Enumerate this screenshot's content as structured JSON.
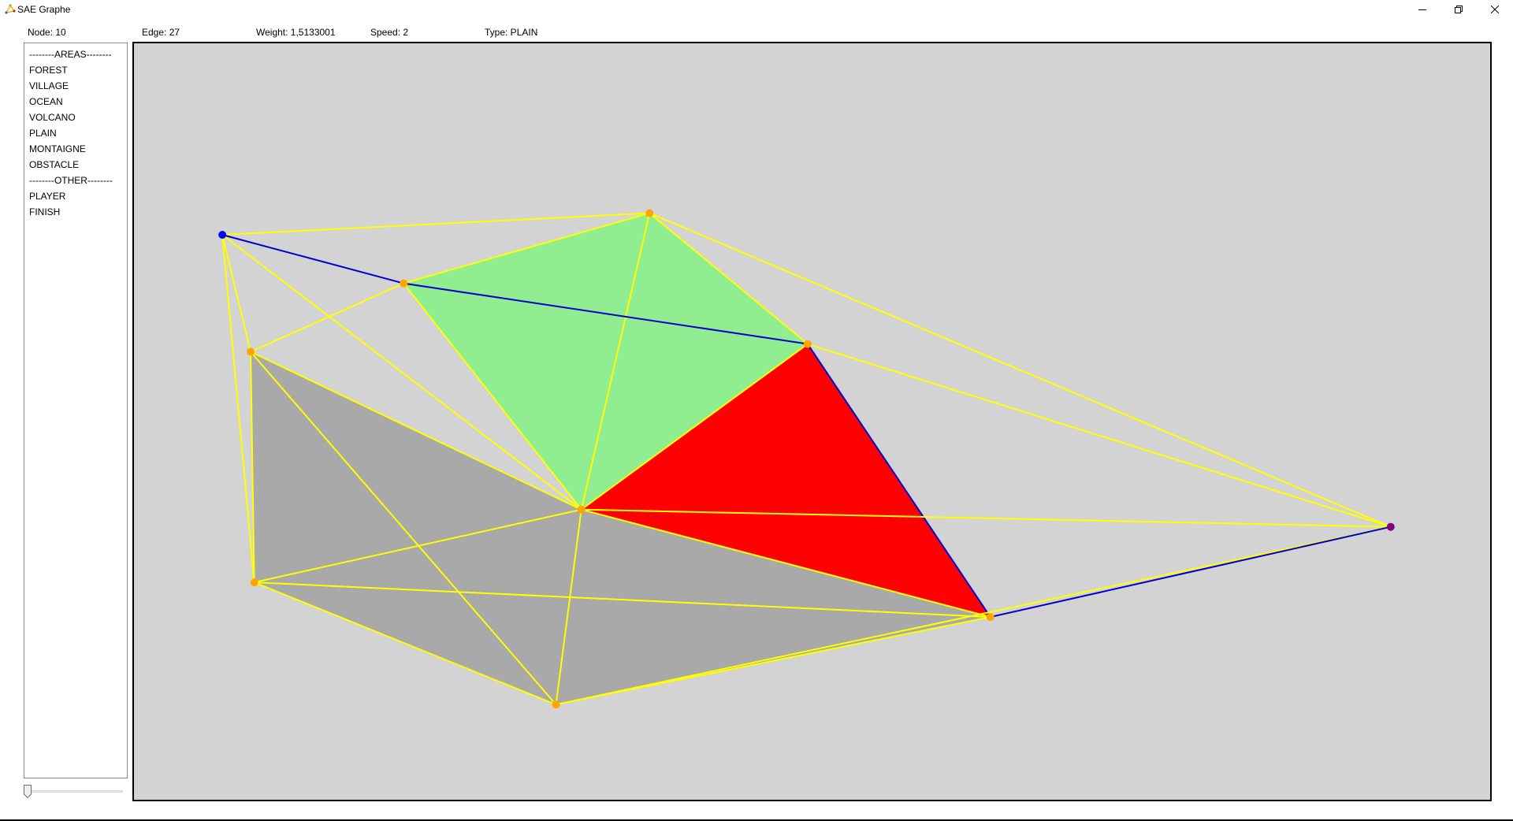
{
  "window": {
    "title": "SAE Graphe"
  },
  "status": {
    "node": "Node: 10",
    "edge": "Edge: 27",
    "weight": "Weight: 1,5133001",
    "speed": "Speed: 2",
    "type": "Type: PLAIN"
  },
  "sidebar": {
    "items": [
      {
        "label": "--------AREAS--------",
        "kind": "header"
      },
      {
        "label": "FOREST",
        "kind": "item"
      },
      {
        "label": "VILLAGE",
        "kind": "item"
      },
      {
        "label": "OCEAN",
        "kind": "item"
      },
      {
        "label": "VOLCANO",
        "kind": "item"
      },
      {
        "label": "PLAIN",
        "kind": "item"
      },
      {
        "label": "MONTAIGNE",
        "kind": "item"
      },
      {
        "label": "OBSTACLE",
        "kind": "item"
      },
      {
        "label": "--------OTHER--------",
        "kind": "header"
      },
      {
        "label": "PLAYER",
        "kind": "item"
      },
      {
        "label": "FINISH",
        "kind": "item"
      }
    ]
  },
  "slider": {
    "value_fraction": 0
  },
  "graph": {
    "colors": {
      "canvas_background": "#d3d3d3",
      "edge_default": "#ffff00",
      "edge_path": "#0000cc",
      "node_default": "#ffa500",
      "node_player": "#0000ff",
      "node_finish": "#800080",
      "area_forest": "#90ee90",
      "area_volcano": "#ff0000",
      "area_montaigne": "#a9a9a9"
    },
    "nodes": [
      {
        "id": "n1",
        "role": "player"
      },
      {
        "id": "n2",
        "role": "default"
      },
      {
        "id": "n3",
        "role": "default"
      },
      {
        "id": "n4",
        "role": "default"
      },
      {
        "id": "n5",
        "role": "default"
      },
      {
        "id": "n6",
        "role": "default"
      },
      {
        "id": "n7",
        "role": "default"
      },
      {
        "id": "n8",
        "role": "default"
      },
      {
        "id": "n9",
        "role": "default"
      },
      {
        "id": "n10",
        "role": "finish"
      }
    ],
    "areas": [
      {
        "type": "FOREST",
        "nodes": [
          "n3",
          "n2",
          "n4"
        ]
      },
      {
        "type": "FOREST",
        "nodes": [
          "n3",
          "n4",
          "n5"
        ]
      },
      {
        "type": "VOLCANO",
        "nodes": [
          "n4",
          "n5",
          "n9"
        ]
      },
      {
        "type": "MONTAIGNE",
        "nodes": [
          "n6",
          "n5",
          "n7"
        ]
      },
      {
        "type": "MONTAIGNE",
        "nodes": [
          "n7",
          "n5",
          "n8"
        ]
      },
      {
        "type": "MONTAIGNE",
        "nodes": [
          "n8",
          "n5",
          "n9"
        ]
      }
    ],
    "edges": [
      {
        "from": "n1",
        "to": "n2",
        "path": false
      },
      {
        "from": "n1",
        "to": "n3",
        "path": true
      },
      {
        "from": "n1",
        "to": "n6",
        "path": false
      },
      {
        "from": "n1",
        "to": "n7",
        "path": false
      },
      {
        "from": "n1",
        "to": "n5",
        "path": false
      },
      {
        "from": "n2",
        "to": "n3",
        "path": false
      },
      {
        "from": "n2",
        "to": "n4",
        "path": false
      },
      {
        "from": "n2",
        "to": "n5",
        "path": false
      },
      {
        "from": "n2",
        "to": "n10",
        "path": false
      },
      {
        "from": "n3",
        "to": "n4",
        "path": true
      },
      {
        "from": "n3",
        "to": "n5",
        "path": false
      },
      {
        "from": "n3",
        "to": "n6",
        "path": false
      },
      {
        "from": "n4",
        "to": "n5",
        "path": false
      },
      {
        "from": "n4",
        "to": "n9",
        "path": true
      },
      {
        "from": "n4",
        "to": "n10",
        "path": false
      },
      {
        "from": "n5",
        "to": "n6",
        "path": false
      },
      {
        "from": "n5",
        "to": "n7",
        "path": false
      },
      {
        "from": "n5",
        "to": "n8",
        "path": false
      },
      {
        "from": "n5",
        "to": "n9",
        "path": false
      },
      {
        "from": "n5",
        "to": "n10",
        "path": false
      },
      {
        "from": "n6",
        "to": "n7",
        "path": false
      },
      {
        "from": "n6",
        "to": "n8",
        "path": false
      },
      {
        "from": "n7",
        "to": "n8",
        "path": false
      },
      {
        "from": "n7",
        "to": "n9",
        "path": false
      },
      {
        "from": "n8",
        "to": "n9",
        "path": false
      },
      {
        "from": "n8",
        "to": "n10",
        "path": false
      },
      {
        "from": "n9",
        "to": "n10",
        "path": true
      }
    ]
  }
}
